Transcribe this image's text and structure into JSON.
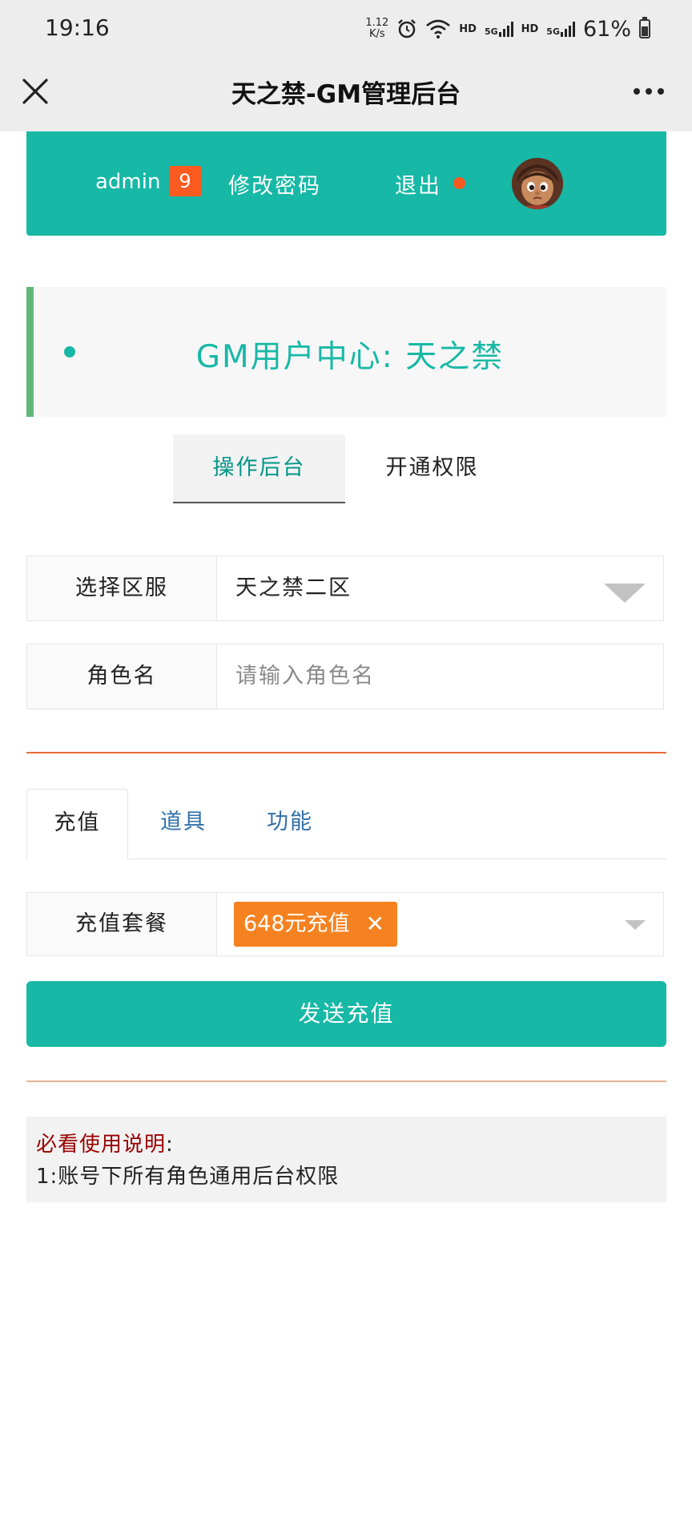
{
  "status_bar": {
    "time": "19:16",
    "net_speed_value": "1.12",
    "net_speed_unit": "K/s",
    "hd_label": "HD",
    "signal_label": "5G",
    "battery_percent": "61%",
    "battery_level": 0.61
  },
  "title_bar": {
    "title": "天之禁-GM管理后台",
    "close_icon": "close-icon",
    "more_icon": "more-icon"
  },
  "user_bar": {
    "username": "admin",
    "badge_count": "9",
    "change_password": "修改密码",
    "logout": "退出",
    "accent_color": "#17b8a6",
    "badge_color": "#fb5a20"
  },
  "hero": {
    "title": "GM用户中心: 天之禁"
  },
  "top_tabs": [
    {
      "label": "操作后台",
      "active": true
    },
    {
      "label": "开通权限",
      "active": false
    }
  ],
  "form": {
    "server": {
      "label": "选择区服",
      "value": "天之禁二区"
    },
    "role": {
      "label": "角色名",
      "placeholder": "请输入角色名"
    }
  },
  "sub_tabs": [
    {
      "label": "充值",
      "active": true
    },
    {
      "label": "道具",
      "active": false
    },
    {
      "label": "功能",
      "active": false
    }
  ],
  "recharge": {
    "label": "充值套餐",
    "selected_tag": "648元充值",
    "remove_symbol": "✕",
    "tag_color": "#f58220"
  },
  "send_button": "发送充值",
  "notice": {
    "title": "必看使用说明",
    "colon": ":",
    "line1": "1:账号下所有角色通用后台权限"
  }
}
